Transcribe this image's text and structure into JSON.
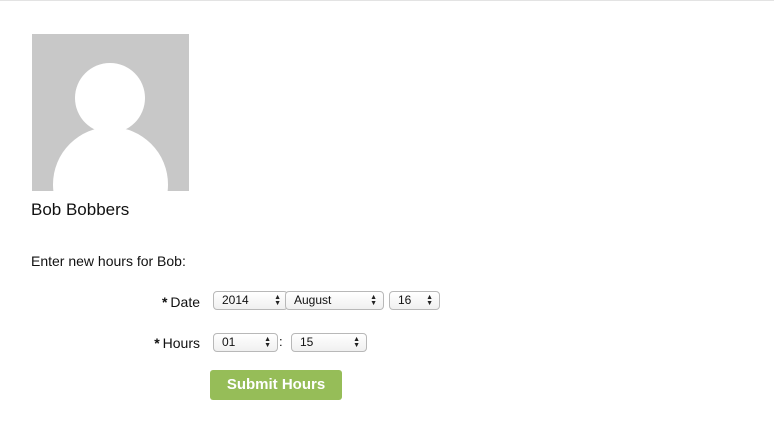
{
  "profile": {
    "name": "Bob Bobbers",
    "avatar_icon": "default-avatar-icon"
  },
  "form": {
    "intro": "Enter new hours for Bob:",
    "required_marker": "*",
    "date_label": "Date",
    "hours_label": "Hours",
    "date": {
      "year": "2014",
      "month": "August",
      "day": "16"
    },
    "hours": {
      "hour": "01",
      "separator": ":",
      "minute": "15"
    },
    "submit_label": "Submit Hours",
    "submit_color": "#96bd58"
  }
}
